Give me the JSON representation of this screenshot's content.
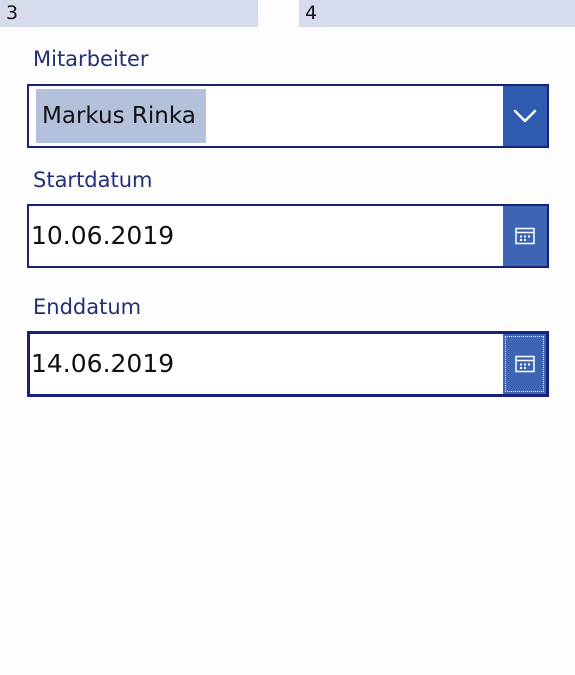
{
  "tabs": [
    {
      "label": "3"
    },
    {
      "label": "4"
    }
  ],
  "form": {
    "employee": {
      "label": "Mitarbeiter",
      "selected": "Markus Rinka",
      "icon": "chevron-down-icon"
    },
    "start_date": {
      "label": "Startdatum",
      "value": "10.06.2019",
      "icon": "calendar-icon"
    },
    "end_date": {
      "label": "Enddatum",
      "value": "14.06.2019",
      "icon": "calendar-icon"
    }
  },
  "colors": {
    "label_text": "#233075",
    "field_border": "#17237a",
    "button_bg": "#2e5bb0",
    "selection_bg": "#b4c1dc",
    "tab_bg": "#d7dcec"
  }
}
